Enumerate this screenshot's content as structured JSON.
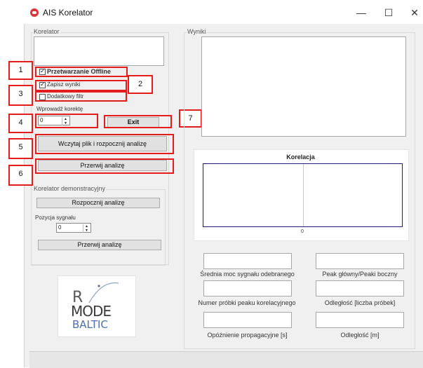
{
  "window": {
    "title": "AIS Korelator",
    "minimize": "—",
    "maximize": "☐",
    "close": "✕"
  },
  "left": {
    "korelator_group": "Korelator",
    "chk_offline": {
      "label": "Przetwarzanie Offline",
      "checked": true
    },
    "chk_zapisz": {
      "label": "Zapisz wyniki",
      "checked": true
    },
    "chk_filtr": {
      "label": "Dodatkowy filtr",
      "checked": false
    },
    "korekta_label": "Wprowadź korektę",
    "korekta_value": "0",
    "exit_button": "Exit",
    "wczytaj_button": "Wczytaj plik i rozpocznij analizę",
    "przerwij_button": "Przerwij analizę",
    "demo_group": "Korelator demonstracyjny",
    "rozpocznij_button": "Rozpocznij analizę",
    "pozycja_label": "Pozycja sygnału",
    "pozycja_value": "0",
    "przerwij2_button": "Przerwij analizę"
  },
  "logo": {
    "r": "R",
    "mode": "MODE",
    "baltic": "BALTIC"
  },
  "callouts": [
    "1",
    "2",
    "3",
    "4",
    "5",
    "6",
    "7"
  ],
  "right": {
    "wyniki_group": "Wyniki",
    "chart_title": "Korelacja",
    "chart_x_tick": "0",
    "fields": {
      "srednia": "Średnia moc sygnału odebranego",
      "peak": "Peak główny/Peaki boczny",
      "numer": "Numer próbki peaku korelacyjnego",
      "odleglosc_probek": "Odległość [liczba próbek]",
      "opoznienie": "Opóźnienie propagacyjne [s]",
      "odleglosc_m": "Odległość [m]"
    }
  },
  "colors": {
    "callout_border": "#e41c1c",
    "chart_title": "#8b1a1a",
    "chart_frame": "#1c1c7a"
  }
}
